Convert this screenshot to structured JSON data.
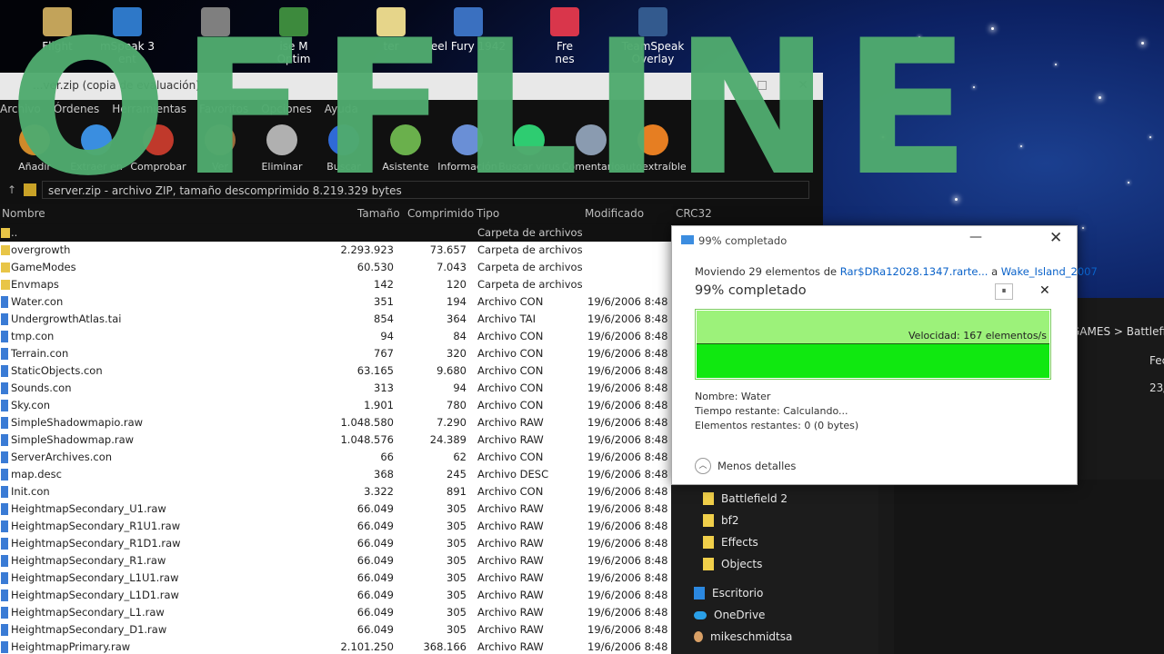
{
  "desktop": {
    "icons": [
      {
        "label": "Flight",
        "color": "#c2a35a"
      },
      {
        "label": "mSpeak 3\nent",
        "color": "#2e78c8"
      },
      {
        "label": "",
        "color": "#7f7f7f"
      },
      {
        "label": "ise M\nOptim",
        "color": "#3d8a3d"
      },
      {
        "label": "ter",
        "color": "#e6d58a"
      },
      {
        "label": "eel Fury 1942",
        "color": "#3a70c0"
      },
      {
        "label": "Fre\nnes",
        "color": "#d9364b"
      },
      {
        "label": "TeamSpeak\nOverlay",
        "color": "#335a8e"
      }
    ]
  },
  "overlay": {
    "text": "OFFLINE",
    "color": "#50aa6e"
  },
  "archiver": {
    "title": "...ver.zip (copia de evaluación)",
    "menu": [
      "Archivo",
      "Órdenes",
      "Herramientas",
      "Favoritos",
      "Opciones",
      "Ayuda"
    ],
    "toolbar": [
      {
        "label": "Añadir",
        "icon": "add-icon",
        "color": "#d08a2a"
      },
      {
        "label": "Extraer en",
        "icon": "extract-folder-icon",
        "color": "#3a8ee0"
      },
      {
        "label": "Comprobar",
        "icon": "test-icon",
        "color": "#c0392b"
      },
      {
        "label": "Ver",
        "icon": "view-book-icon",
        "color": "#9c6b3a"
      },
      {
        "label": "Eliminar",
        "icon": "trash-icon",
        "color": "#b0b0b0"
      },
      {
        "label": "Buscar",
        "icon": "search-icon",
        "color": "#2f6ad6"
      },
      {
        "label": "Asistente",
        "icon": "wizard-icon",
        "color": "#6ab04c"
      },
      {
        "label": "Información",
        "icon": "info-icon",
        "color": "#6a8fd6"
      },
      {
        "label": "Buscar virus",
        "icon": "virus-scan-icon",
        "color": "#2ecc71"
      },
      {
        "label": "Comentario",
        "icon": "comment-icon",
        "color": "#8a9bb0"
      },
      {
        "label": "autoextraíble",
        "icon": "sfx-icon",
        "color": "#e67e22"
      }
    ],
    "path": "server.zip - archivo ZIP, tamaño descomprimido 8.219.329 bytes",
    "columns": {
      "name": "Nombre",
      "size": "Tamaño",
      "comp": "Comprimido",
      "type": "Tipo",
      "mod": "Modificado",
      "crc": "CRC32"
    },
    "rows": [
      {
        "name": "..",
        "size": "",
        "comp": "",
        "type": "Carpeta de archivos",
        "mod": "",
        "folder": true,
        "dark": true
      },
      {
        "name": "overgrowth",
        "size": "2.293.923",
        "comp": "73.657",
        "type": "Carpeta de archivos",
        "mod": "",
        "folder": true
      },
      {
        "name": "GameModes",
        "size": "60.530",
        "comp": "7.043",
        "type": "Carpeta de archivos",
        "mod": "",
        "folder": true
      },
      {
        "name": "Envmaps",
        "size": "142",
        "comp": "120",
        "type": "Carpeta de archivos",
        "mod": "",
        "folder": true
      },
      {
        "name": "Water.con",
        "size": "351",
        "comp": "194",
        "type": "Archivo CON",
        "mod": "19/6/2006 8:48 ..."
      },
      {
        "name": "UndergrowthAtlas.tai",
        "size": "854",
        "comp": "364",
        "type": "Archivo TAI",
        "mod": "19/6/2006 8:48 ..."
      },
      {
        "name": "tmp.con",
        "size": "94",
        "comp": "84",
        "type": "Archivo CON",
        "mod": "19/6/2006 8:48 ..."
      },
      {
        "name": "Terrain.con",
        "size": "767",
        "comp": "320",
        "type": "Archivo CON",
        "mod": "19/6/2006 8:48 ..."
      },
      {
        "name": "StaticObjects.con",
        "size": "63.165",
        "comp": "9.680",
        "type": "Archivo CON",
        "mod": "19/6/2006 8:48 ..."
      },
      {
        "name": "Sounds.con",
        "size": "313",
        "comp": "94",
        "type": "Archivo CON",
        "mod": "19/6/2006 8:48 ..."
      },
      {
        "name": "Sky.con",
        "size": "1.901",
        "comp": "780",
        "type": "Archivo CON",
        "mod": "19/6/2006 8:48 ..."
      },
      {
        "name": "SimpleShadowmapio.raw",
        "size": "1.048.580",
        "comp": "7.290",
        "type": "Archivo RAW",
        "mod": "19/6/2006 8:48 ..."
      },
      {
        "name": "SimpleShadowmap.raw",
        "size": "1.048.576",
        "comp": "24.389",
        "type": "Archivo RAW",
        "mod": "19/6/2006 8:48 ..."
      },
      {
        "name": "ServerArchives.con",
        "size": "66",
        "comp": "62",
        "type": "Archivo CON",
        "mod": "19/6/2006 8:48 ..."
      },
      {
        "name": "map.desc",
        "size": "368",
        "comp": "245",
        "type": "Archivo DESC",
        "mod": "19/6/2006 8:48 ..."
      },
      {
        "name": "Init.con",
        "size": "3.322",
        "comp": "891",
        "type": "Archivo CON",
        "mod": "19/6/2006 8:48 ..."
      },
      {
        "name": "HeightmapSecondary_U1.raw",
        "size": "66.049",
        "comp": "305",
        "type": "Archivo RAW",
        "mod": "19/6/2006 8:48 ..."
      },
      {
        "name": "HeightmapSecondary_R1U1.raw",
        "size": "66.049",
        "comp": "305",
        "type": "Archivo RAW",
        "mod": "19/6/2006 8:48 ..."
      },
      {
        "name": "HeightmapSecondary_R1D1.raw",
        "size": "66.049",
        "comp": "305",
        "type": "Archivo RAW",
        "mod": "19/6/2006 8:48 ..."
      },
      {
        "name": "HeightmapSecondary_R1.raw",
        "size": "66.049",
        "comp": "305",
        "type": "Archivo RAW",
        "mod": "19/6/2006 8:48 ..."
      },
      {
        "name": "HeightmapSecondary_L1U1.raw",
        "size": "66.049",
        "comp": "305",
        "type": "Archivo RAW",
        "mod": "19/6/2006 8:48 ..."
      },
      {
        "name": "HeightmapSecondary_L1D1.raw",
        "size": "66.049",
        "comp": "305",
        "type": "Archivo RAW",
        "mod": "19/6/2006 8:48 ..."
      },
      {
        "name": "HeightmapSecondary_L1.raw",
        "size": "66.049",
        "comp": "305",
        "type": "Archivo RAW",
        "mod": "19/6/2006 8:48 ..."
      },
      {
        "name": "HeightmapSecondary_D1.raw",
        "size": "66.049",
        "comp": "305",
        "type": "Archivo RAW",
        "mod": "19/6/2006 8:48 ..."
      },
      {
        "name": "HeightmapPrimary.raw",
        "size": "2.101.250",
        "comp": "368.166",
        "type": "Archivo RAW",
        "mod": "19/6/2006 8:48 ..."
      }
    ]
  },
  "copy_dialog": {
    "title": "99% completado",
    "move_prefix": "Moviendo 29 elementos de ",
    "move_src": "Rar$DRa12028.1347.rarte...",
    "move_mid": " a ",
    "move_dst": "Wake_Island_2007",
    "percent_text": "99% completado",
    "progress": 0.99,
    "speed": "Velocidad: 167 elementos/s",
    "name_line": "Nombre:  Water",
    "time_line": "Tiempo restante:  Calculando...",
    "items_line": "Elementos restantes:  0 (0 bytes)",
    "less_details": "Menos detalles",
    "pause_glyph": "⏸",
    "close_glyph": "✕",
    "min_glyph": "—"
  },
  "explorer": {
    "breadcrumb": "GAMES  >  Battlefie",
    "col_fec": "Fec",
    "date_fragment": "23/",
    "tree": [
      {
        "label": "Battlefield 2",
        "kind": "folder"
      },
      {
        "label": "bf2",
        "kind": "folder"
      },
      {
        "label": "Effects",
        "kind": "folder"
      },
      {
        "label": "Objects",
        "kind": "folder"
      },
      {
        "label": "Escritorio",
        "kind": "blue"
      },
      {
        "label": "OneDrive",
        "kind": "cloud"
      },
      {
        "label": "mikeschmidtsa",
        "kind": "user"
      }
    ]
  }
}
